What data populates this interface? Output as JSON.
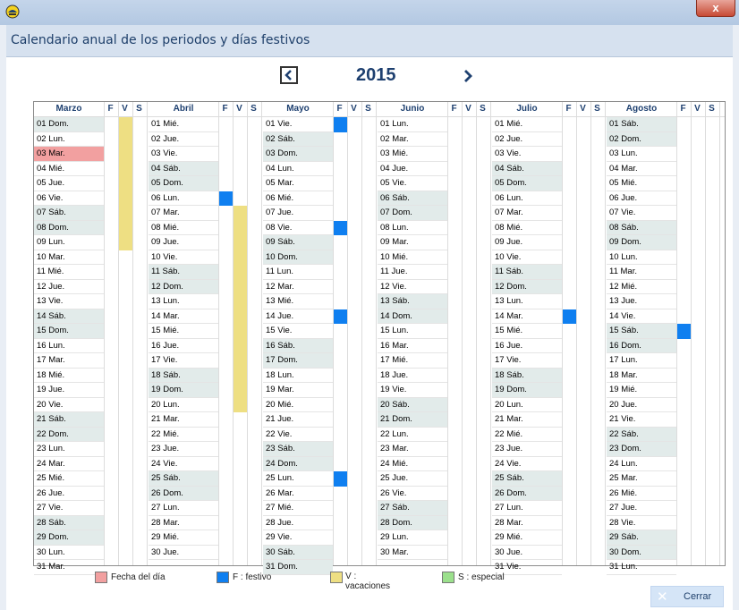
{
  "window": {
    "title": "Calendario anual de los periodos y días festivos",
    "close_glyph": "x"
  },
  "nav": {
    "year": "2015"
  },
  "flags": [
    "F",
    "V",
    "S"
  ],
  "colors": {
    "today": "#f2a0a0",
    "festivo": "#0f7ff0",
    "vacaciones": "#eedf83",
    "especial": "#9be08c",
    "weekend": "#e2ebea"
  },
  "months": [
    {
      "name": "Marzo",
      "days": [
        "01 Dom.",
        "02 Lun.",
        "03 Mar.",
        "04 Mié.",
        "05 Jue.",
        "06 Vie.",
        "07 Sáb.",
        "08 Dom.",
        "09 Lun.",
        "10 Mar.",
        "11 Mié.",
        "12 Jue.",
        "13 Vie.",
        "14 Sáb.",
        "15 Dom.",
        "16 Lun.",
        "17 Mar.",
        "18 Mié.",
        "19 Jue.",
        "20 Vie.",
        "21 Sáb.",
        "22 Dom.",
        "23 Lun.",
        "24 Mar.",
        "25 Mié.",
        "26 Jue.",
        "27 Vie.",
        "28 Sáb.",
        "29 Dom.",
        "30 Lun.",
        "31 Mar."
      ],
      "weekend": [
        1,
        7,
        8,
        14,
        15,
        21,
        22,
        28,
        29
      ],
      "today": [
        3
      ],
      "festivo": [],
      "vacaciones": [
        1,
        2,
        3,
        4,
        5,
        6,
        7,
        8,
        9
      ]
    },
    {
      "name": "Abril",
      "days": [
        "01 Mié.",
        "02 Jue.",
        "03 Vie.",
        "04 Sáb.",
        "05 Dom.",
        "06 Lun.",
        "07 Mar.",
        "08 Mié.",
        "09 Jue.",
        "10 Vie.",
        "11 Sáb.",
        "12 Dom.",
        "13 Lun.",
        "14 Mar.",
        "15 Mié.",
        "16 Jue.",
        "17 Vie.",
        "18 Sáb.",
        "19 Dom.",
        "20 Lun.",
        "21 Mar.",
        "22 Mié.",
        "23 Jue.",
        "24 Vie.",
        "25 Sáb.",
        "26 Dom.",
        "27 Lun.",
        "28 Mar.",
        "29 Mié.",
        "30 Jue."
      ],
      "weekend": [
        4,
        5,
        11,
        12,
        18,
        19,
        25,
        26
      ],
      "today": [],
      "festivo": [
        6
      ],
      "vacaciones": [
        7,
        8,
        9,
        10,
        11,
        12,
        13,
        14,
        15,
        16,
        17,
        18,
        19,
        20
      ]
    },
    {
      "name": "Mayo",
      "days": [
        "01 Vie.",
        "02 Sáb.",
        "03 Dom.",
        "04 Lun.",
        "05 Mar.",
        "06 Mié.",
        "07 Jue.",
        "08 Vie.",
        "09 Sáb.",
        "10 Dom.",
        "11 Lun.",
        "12 Mar.",
        "13 Mié.",
        "14 Jue.",
        "15 Vie.",
        "16 Sáb.",
        "17 Dom.",
        "18 Lun.",
        "19 Mar.",
        "20 Mié.",
        "21 Jue.",
        "22 Vie.",
        "23 Sáb.",
        "24 Dom.",
        "25 Lun.",
        "26 Mar.",
        "27 Mié.",
        "28 Jue.",
        "29 Vie.",
        "30 Sáb.",
        "31 Dom."
      ],
      "weekend": [
        2,
        3,
        9,
        10,
        16,
        17,
        23,
        24,
        30,
        31
      ],
      "today": [],
      "festivo": [
        1,
        8,
        14,
        25
      ],
      "vacaciones": []
    },
    {
      "name": "Junio",
      "days": [
        "01 Lun.",
        "02 Mar.",
        "03 Mié.",
        "04 Jue.",
        "05 Vie.",
        "06 Sáb.",
        "07 Dom.",
        "08 Lun.",
        "09 Mar.",
        "10 Mié.",
        "11 Jue.",
        "12 Vie.",
        "13 Sáb.",
        "14 Dom.",
        "15 Lun.",
        "16 Mar.",
        "17 Mié.",
        "18 Jue.",
        "19 Vie.",
        "20 Sáb.",
        "21 Dom.",
        "22 Lun.",
        "23 Mar.",
        "24 Mié.",
        "25 Jue.",
        "26 Vie.",
        "27 Sáb.",
        "28 Dom.",
        "29 Lun.",
        "30 Mar."
      ],
      "weekend": [
        6,
        7,
        13,
        14,
        20,
        21,
        27,
        28
      ],
      "today": [],
      "festivo": [],
      "vacaciones": []
    },
    {
      "name": "Julio",
      "days": [
        "01 Mié.",
        "02 Jue.",
        "03 Vie.",
        "04 Sáb.",
        "05 Dom.",
        "06 Lun.",
        "07 Mar.",
        "08 Mié.",
        "09 Jue.",
        "10 Vie.",
        "11 Sáb.",
        "12 Dom.",
        "13 Lun.",
        "14 Mar.",
        "15 Mié.",
        "16 Jue.",
        "17 Vie.",
        "18 Sáb.",
        "19 Dom.",
        "20 Lun.",
        "21 Mar.",
        "22 Mié.",
        "23 Jue.",
        "24 Vie.",
        "25 Sáb.",
        "26 Dom.",
        "27 Lun.",
        "28 Mar.",
        "29 Mié.",
        "30 Jue.",
        "31 Vie."
      ],
      "weekend": [
        4,
        5,
        11,
        12,
        18,
        19,
        25,
        26
      ],
      "today": [],
      "festivo": [
        14
      ],
      "vacaciones": []
    },
    {
      "name": "Agosto",
      "days": [
        "01 Sáb.",
        "02 Dom.",
        "03 Lun.",
        "04 Mar.",
        "05 Mié.",
        "06 Jue.",
        "07 Vie.",
        "08 Sáb.",
        "09 Dom.",
        "10 Lun.",
        "11 Mar.",
        "12 Mié.",
        "13 Jue.",
        "14 Vie.",
        "15 Sáb.",
        "16 Dom.",
        "17 Lun.",
        "18 Mar.",
        "19 Mié.",
        "20 Jue.",
        "21 Vie.",
        "22 Sáb.",
        "23 Dom.",
        "24 Lun.",
        "25 Mar.",
        "26 Mié.",
        "27 Jue.",
        "28 Vie.",
        "29 Sáb.",
        "30 Dom.",
        "31 Lun."
      ],
      "weekend": [
        1,
        2,
        8,
        9,
        15,
        16,
        22,
        23,
        29,
        30
      ],
      "today": [],
      "festivo": [
        15
      ],
      "vacaciones": []
    }
  ],
  "legend": {
    "today": "Fecha del día",
    "festivo": "F : festivo",
    "vacaciones_1": "V :",
    "vacaciones_2": "vacaciones",
    "especial": "S : especial"
  },
  "buttons": {
    "close": "Cerrar"
  }
}
